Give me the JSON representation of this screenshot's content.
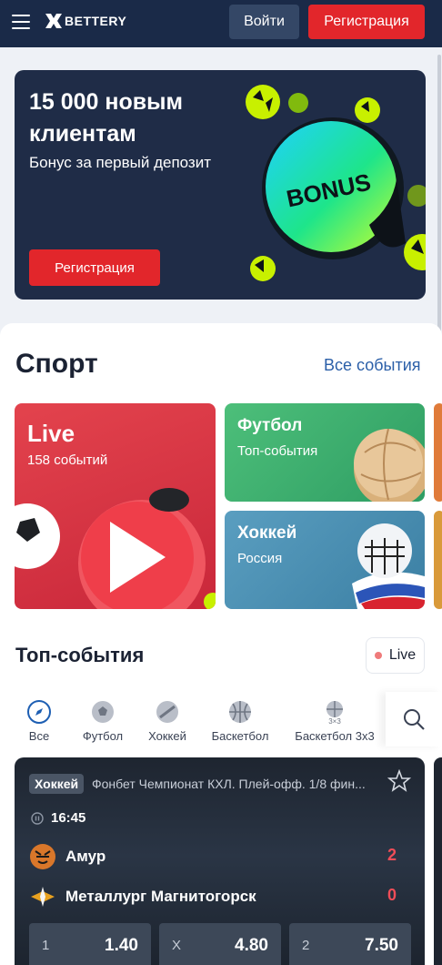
{
  "header": {
    "brand": "BETTERY",
    "login_label": "Войти",
    "register_label": "Регистрация"
  },
  "banner": {
    "title": "15 000 новым клиентам",
    "subtitle": "Бонус за первый депозит",
    "button_label": "Регистрация",
    "art_text": "BONUS"
  },
  "sport": {
    "title": "Спорт",
    "all_events_label": "Все события",
    "cards": [
      {
        "title": "Live",
        "subtitle": "158 событий"
      },
      {
        "title": "Футбол",
        "subtitle": "Топ-события"
      },
      {
        "title": "Хоккей",
        "subtitle": "Россия"
      }
    ]
  },
  "top_events": {
    "title": "Топ-события",
    "live_label": "Live",
    "filters": [
      {
        "label": "Все",
        "icon": "compass-icon"
      },
      {
        "label": "Футбол",
        "icon": "football-icon"
      },
      {
        "label": "Хоккей",
        "icon": "hockey-icon"
      },
      {
        "label": "Баскетбол",
        "icon": "basketball-icon"
      },
      {
        "label": "Баскетбол 3x3",
        "icon": "basketball-3x3-icon",
        "icon_caption": "3×3"
      }
    ],
    "match": {
      "sport": "Хоккей",
      "league": "Фонбет Чемпионат КХЛ. Плей-офф. 1/8 фин...",
      "time": "16:45",
      "team1": "Амур",
      "score1": "2",
      "team2": "Металлург Магнитогорск",
      "score2": "0",
      "odds": [
        {
          "key": "1",
          "value": "1.40"
        },
        {
          "key": "X",
          "value": "4.80"
        },
        {
          "key": "2",
          "value": "7.50"
        }
      ]
    }
  },
  "colors": {
    "header_bg": "#1a2a48",
    "accent_red": "#e2262b",
    "link_blue": "#2b5fa8",
    "score_red": "#f04d58"
  }
}
